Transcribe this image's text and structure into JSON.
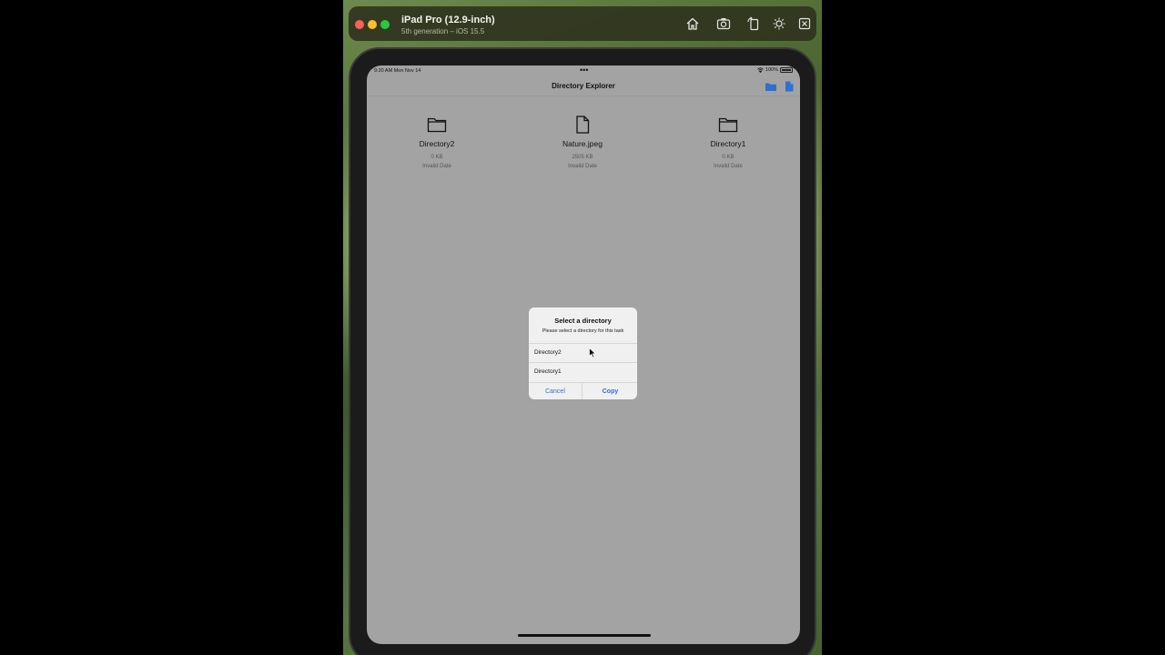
{
  "simulator": {
    "device_name": "iPad Pro (12.9-inch)",
    "device_subtitle": "5th generation – iOS 15.5",
    "toolbar_icons": [
      "home-icon",
      "screenshot-icon",
      "rotate-icon",
      "appearance-icon",
      "close-icon"
    ]
  },
  "statusbar": {
    "time": "9:20 AM   Mon Nov 14",
    "dots": "•••",
    "battery": "100%"
  },
  "navbar": {
    "title": "Directory Explorer",
    "icons": [
      "new-folder-icon",
      "new-file-icon"
    ],
    "accent": "#2f6fd0"
  },
  "items": [
    {
      "name": "Directory2",
      "size": "0 KB",
      "date": "Invalid Date",
      "icon": "folder-icon"
    },
    {
      "name": "Nature.jpeg",
      "size": "2505 KB",
      "date": "Invalid Date",
      "icon": "file-icon"
    },
    {
      "name": "Directory1",
      "size": "0 KB",
      "date": "Invalid Date",
      "icon": "folder-icon"
    }
  ],
  "dialog": {
    "title": "Select a directory",
    "message": "Please select a directory for this task",
    "options": [
      "Directory2",
      "Directory1"
    ],
    "cancel_label": "Cancel",
    "copy_label": "Copy"
  }
}
